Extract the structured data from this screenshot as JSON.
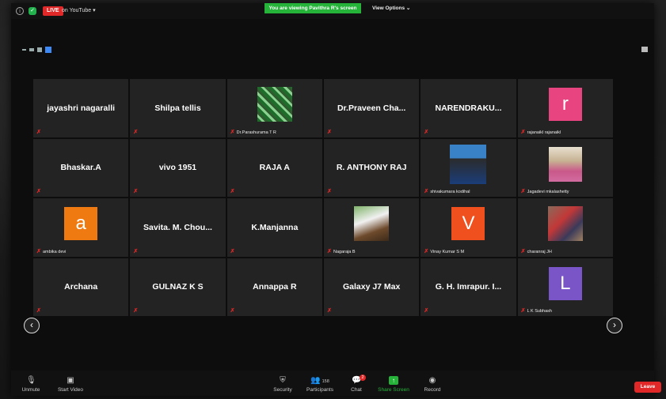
{
  "topbar": {
    "live": "LIVE",
    "youtube": "on YouTube",
    "banner": "You are viewing Pavithra R's screen",
    "view_options": "View Options"
  },
  "tiles": [
    {
      "name": "jayashri nagaralli"
    },
    {
      "name": "Shilpa tellis"
    },
    {
      "name": "",
      "photo": "green",
      "label": "Dr.Parashurama T R"
    },
    {
      "name": "Dr.Praveen  Cha..."
    },
    {
      "name": "NARENDRAKU..."
    },
    {
      "letter": "r",
      "color": "#e8447f",
      "label": "rajanaikl rajanaikl"
    },
    {
      "name": "Bhaskar.A"
    },
    {
      "name": "vivo 1951"
    },
    {
      "name": "RAJA A"
    },
    {
      "name": "R. ANTHONY RAJ"
    },
    {
      "name": "",
      "photo": "man",
      "label": "shivakumara kodihal"
    },
    {
      "name": "",
      "photo": "woman",
      "label": "Jagadevi mkalashetty"
    },
    {
      "letter": "a",
      "color": "#f07a12",
      "label": "ambika devi"
    },
    {
      "name": "Savita. M. Chou..."
    },
    {
      "name": "K.Manjanna"
    },
    {
      "name": "",
      "photo": "boy",
      "label": "Nagaraja B"
    },
    {
      "letter": "V",
      "color": "#f0501e",
      "label": "Vinay Kumar S M"
    },
    {
      "name": "",
      "photo": "kids",
      "label": "charanraj JH"
    },
    {
      "name": "Archana"
    },
    {
      "name": "GULNAZ K S"
    },
    {
      "name": "Annappa R"
    },
    {
      "name": "Galaxy J7 Max"
    },
    {
      "name": "G. H. Imrapur. I..."
    },
    {
      "letter": "L",
      "color": "#7a55c8",
      "label": "L K Subhash"
    }
  ],
  "toolbar": {
    "unmute": "Unmute",
    "start_video": "Start Video",
    "security": "Security",
    "participants": "Participants",
    "participants_count": "158",
    "chat": "Chat",
    "chat_badge": "2",
    "share_screen": "Share Screen",
    "record": "Record",
    "leave": "Leave"
  }
}
